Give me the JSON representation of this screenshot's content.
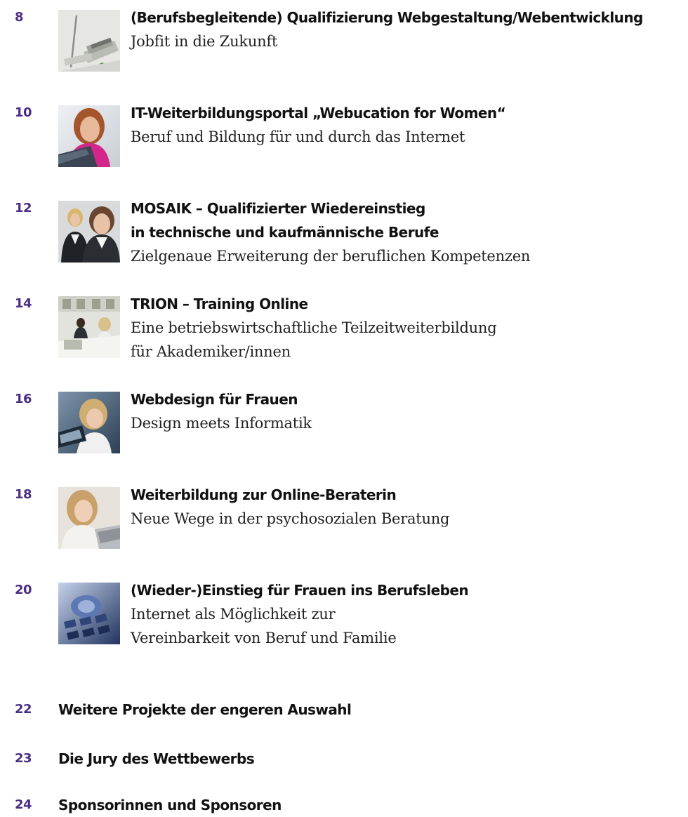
{
  "entries": [
    {
      "page": "8",
      "title_lines": [
        "(Berufsbegleitende) Qualifizierung Webgestaltung/Webentwicklung"
      ],
      "subtitle_lines": [
        "Jobfit in die Zukunft"
      ],
      "image": "under-construction-photo"
    },
    {
      "page": "10",
      "title_lines": [
        "IT-Weiterbildungsportal „Webucation for Women“"
      ],
      "subtitle_lines": [
        "Beruf und Bildung für und durch das Internet"
      ],
      "image": "woman-with-laptop-photo"
    },
    {
      "page": "12",
      "title_lines": [
        "MOSAIK – Qualifizierter Wiedereinstieg",
        "in technische und kaufmännische Berufe"
      ],
      "subtitle_lines": [
        "Zielgenaue Erweiterung der beruflichen Kompetenzen"
      ],
      "image": "two-businesswomen-photo"
    },
    {
      "page": "14",
      "title_lines": [
        "TRION – Training Online"
      ],
      "subtitle_lines": [
        "Eine betriebswirtschaftliche Teilzeitweiterbildung",
        "für Akademiker/innen"
      ],
      "image": "office-training-photo"
    },
    {
      "page": "16",
      "title_lines": [
        "Webdesign für Frauen"
      ],
      "subtitle_lines": [
        "Design meets Informatik"
      ],
      "image": "woman-at-desk-photo"
    },
    {
      "page": "18",
      "title_lines": [
        "Weiterbildung zur Online-Beraterin"
      ],
      "subtitle_lines": [
        "Neue Wege in der psychosozialen Beratung"
      ],
      "image": "woman-at-computer-photo"
    },
    {
      "page": "20",
      "title_lines": [
        "(Wieder-)Einstieg für Frauen ins Berufsleben"
      ],
      "subtitle_lines": [
        "Internet als Möglichkeit zur",
        "Vereinbarkeit von Beruf und Familie"
      ],
      "image": "phone-keypad-photo"
    }
  ],
  "simple_entries": [
    {
      "page": "22",
      "title": "Weitere Projekte der engeren Auswahl"
    },
    {
      "page": "23",
      "title": "Die Jury des Wettbewerbs"
    },
    {
      "page": "24",
      "title": "Sponsorinnen und Sponsoren"
    }
  ],
  "colors": {
    "page_number": "#4b2e83",
    "title": "#111111",
    "subtitle": "#222222",
    "background": "#ffffff"
  }
}
